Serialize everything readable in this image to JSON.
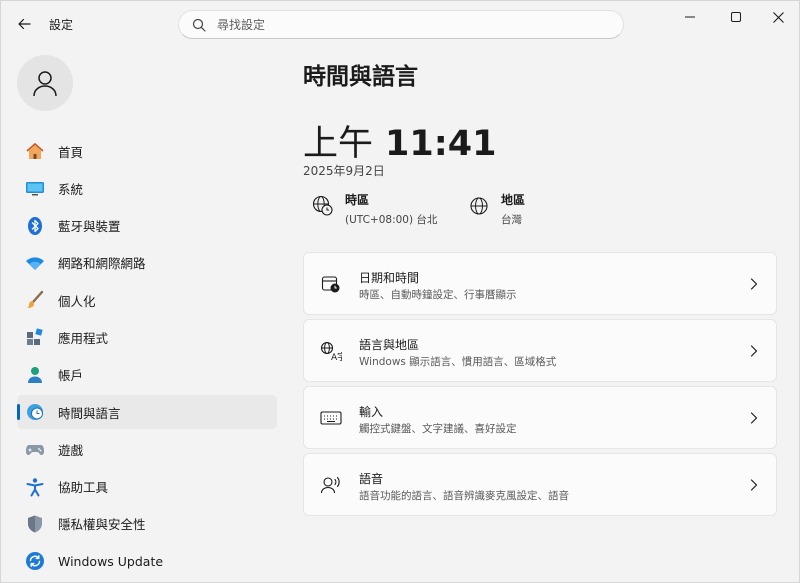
{
  "app": {
    "title": "設定"
  },
  "search": {
    "placeholder": "尋找設定"
  },
  "sidebar": {
    "items": [
      {
        "label": "首頁",
        "icon": "home-icon"
      },
      {
        "label": "系統",
        "icon": "display-icon"
      },
      {
        "label": "藍牙與裝置",
        "icon": "bluetooth-icon"
      },
      {
        "label": "網路和網際網路",
        "icon": "wifi-icon"
      },
      {
        "label": "個人化",
        "icon": "brush-icon"
      },
      {
        "label": "應用程式",
        "icon": "apps-icon"
      },
      {
        "label": "帳戶",
        "icon": "person-icon"
      },
      {
        "label": "時間與語言",
        "icon": "clock-globe-icon",
        "active": true
      },
      {
        "label": "遊戲",
        "icon": "gamepad-icon"
      },
      {
        "label": "協助工具",
        "icon": "accessibility-icon"
      },
      {
        "label": "隱私權與安全性",
        "icon": "shield-icon"
      },
      {
        "label": "Windows Update",
        "icon": "windows-update-icon"
      }
    ]
  },
  "main": {
    "title": "時間與語言",
    "clock": {
      "ampm": "上午",
      "time": "11:41"
    },
    "date": "2025年9月2日",
    "timezone": {
      "title": "時區",
      "value": "(UTC+08:00) 台北"
    },
    "region": {
      "title": "地區",
      "value": "台灣"
    },
    "cards": [
      {
        "title": "日期和時間",
        "subtitle": "時區、自動時鐘設定、行事曆顯示",
        "icon": "calendar-clock-icon"
      },
      {
        "title": "語言與地區",
        "subtitle": "Windows 顯示語言、慣用語言、區域格式",
        "icon": "language-icon"
      },
      {
        "title": "輸入",
        "subtitle": "觸控式鍵盤、文字建議、喜好設定",
        "icon": "keyboard-icon"
      },
      {
        "title": "語音",
        "subtitle": "語音功能的語言、語音辨識麥克風設定、語音",
        "icon": "speech-icon"
      }
    ]
  },
  "colors": {
    "accent": "#0067c0",
    "background": "#f3f3f3",
    "card": "#fbfbfb"
  }
}
